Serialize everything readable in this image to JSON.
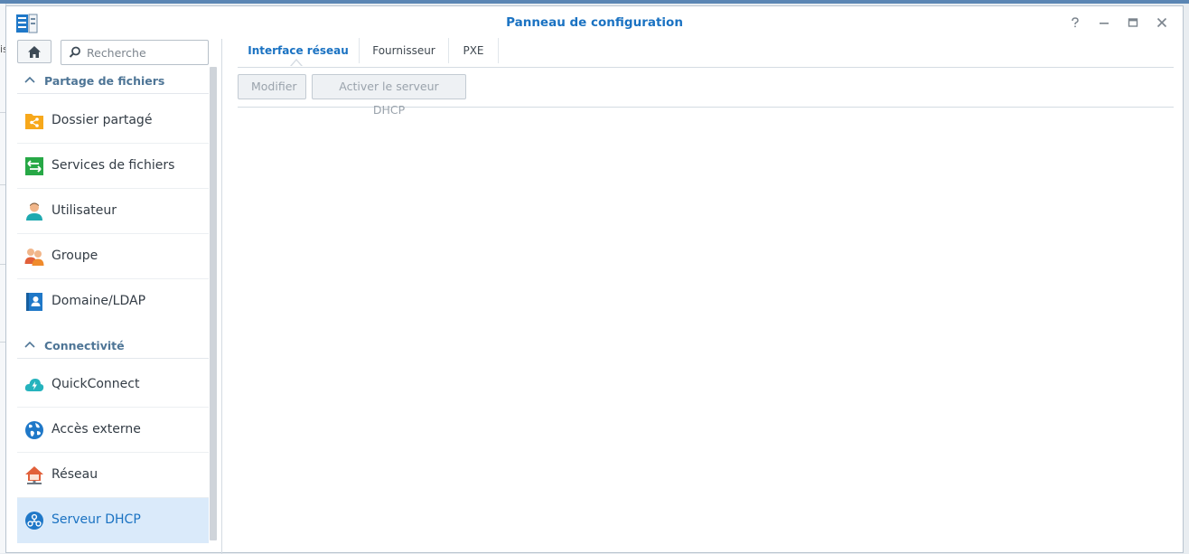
{
  "window": {
    "title": "Panneau de configuration",
    "background_fragment": "is"
  },
  "sidebar": {
    "search_placeholder": "Recherche",
    "sections": [
      {
        "label": "Partage de fichiers",
        "items": [
          {
            "label": "Dossier partagé",
            "icon": "shared-folder-icon"
          },
          {
            "label": "Services de fichiers",
            "icon": "file-services-icon"
          },
          {
            "label": "Utilisateur",
            "icon": "user-icon"
          },
          {
            "label": "Groupe",
            "icon": "group-icon"
          },
          {
            "label": "Domaine/LDAP",
            "icon": "domain-ldap-icon"
          }
        ]
      },
      {
        "label": "Connectivité",
        "items": [
          {
            "label": "QuickConnect",
            "icon": "quickconnect-icon"
          },
          {
            "label": "Accès externe",
            "icon": "external-access-icon"
          },
          {
            "label": "Réseau",
            "icon": "network-icon"
          },
          {
            "label": "Serveur DHCP",
            "icon": "dhcp-server-icon",
            "active": true
          }
        ]
      }
    ]
  },
  "main": {
    "tabs": [
      {
        "label": "Interface réseau",
        "active": true
      },
      {
        "label": "Fournisseur"
      },
      {
        "label": "PXE"
      }
    ],
    "toolbar": {
      "modify_label": "Modifier",
      "enable_dhcp_label": "Activer le serveur DHCP"
    }
  },
  "colors": {
    "accent": "#1a72c2",
    "section_header": "#4e7596",
    "active_item_bg": "#daeafa"
  }
}
